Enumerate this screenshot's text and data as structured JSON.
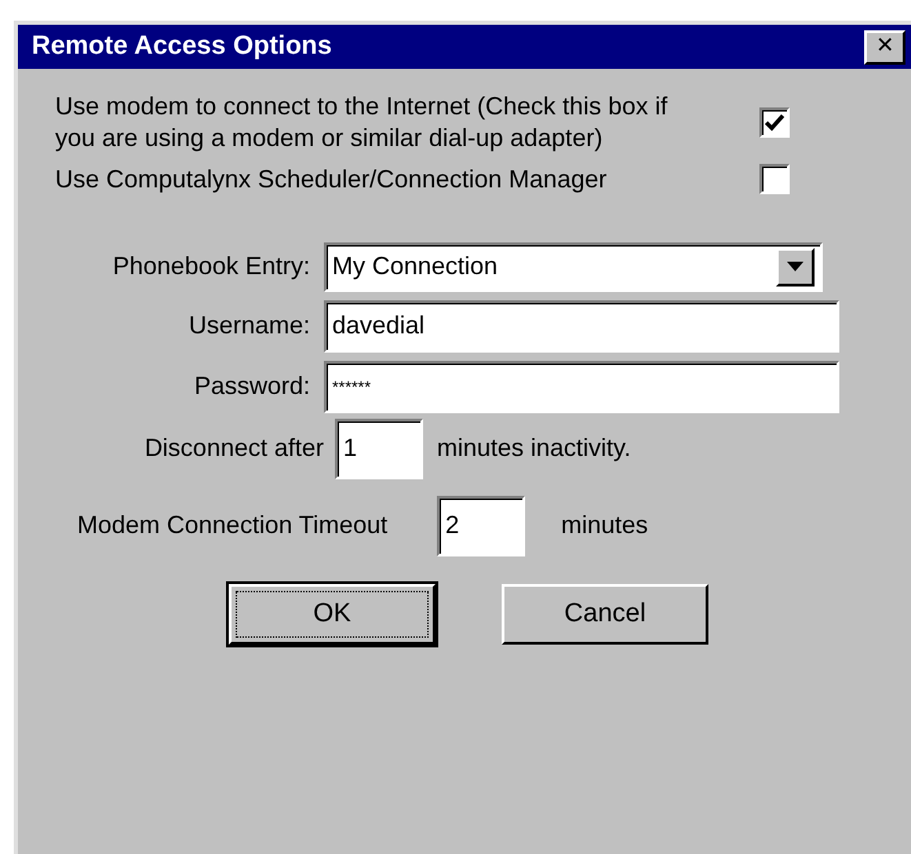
{
  "window": {
    "title": "Remote Access Options",
    "close": "✕"
  },
  "options": [
    {
      "label": "Use modem to connect to the Internet (Check this box if you are using a modem or similar dial-up adapter)",
      "checked": true
    },
    {
      "label": "Use Computalynx Scheduler/Connection Manager",
      "checked": false
    }
  ],
  "phonebook": {
    "label": "Phonebook Entry:",
    "value": "My Connection"
  },
  "fields": [
    {
      "label": "Username:",
      "value": "davedial"
    },
    {
      "label": "Password:",
      "value": "******"
    }
  ],
  "disconnect": {
    "label": "Disconnect after",
    "value": "1",
    "suffix": "minutes inactivity."
  },
  "timeout": {
    "label": "Modem Connection Timeout",
    "value": "2",
    "suffix": "minutes"
  },
  "buttons": [
    {
      "label": "OK",
      "focused": true
    },
    {
      "label": "Cancel",
      "focused": false
    }
  ]
}
